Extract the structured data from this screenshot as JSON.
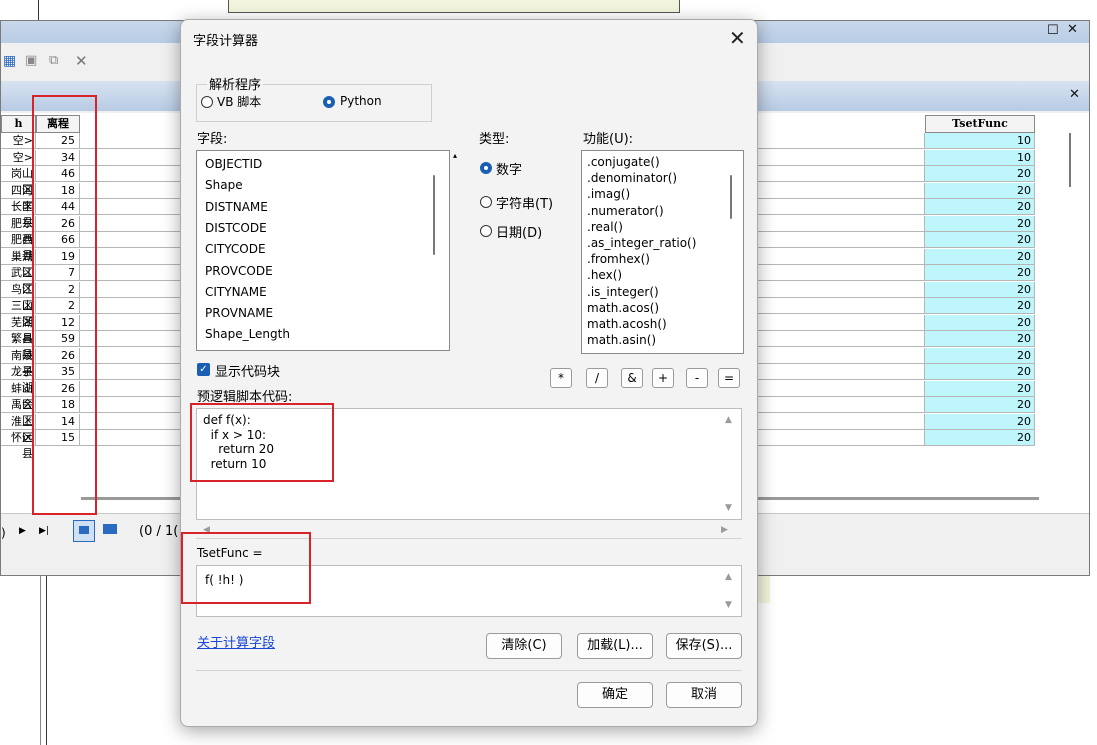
{
  "table": {
    "col_left_header": "h",
    "col_mileage_header": "离程",
    "col_func_header": "TsetFunc",
    "left_names": [
      "空>",
      "空>",
      "岗山区",
      "四河区",
      "长丰县",
      "肥东县",
      "肥西县",
      "巢湖区",
      "武江区",
      "鸟江区",
      "三山区",
      "芜湖县",
      "繁昌县",
      "南陵县",
      "龙子湖",
      "蚌山区",
      "禹会区",
      "淮上区",
      "怀远县"
    ],
    "mileage": [
      "25",
      "34",
      "46",
      "18",
      "44",
      "26",
      "66",
      "19",
      "7",
      "2",
      "2",
      "12",
      "59",
      "26",
      "35",
      "26",
      "18",
      "14",
      "15"
    ],
    "tsetfunc": [
      "10",
      "10",
      "20",
      "20",
      "20",
      "20",
      "20",
      "20",
      "20",
      "20",
      "20",
      "20",
      "20",
      "20",
      "20",
      "20",
      "20",
      "20",
      "20"
    ],
    "record_count": "(0 / 1("
  },
  "dialog": {
    "title": "字段计算器",
    "parser_label": "解析程序",
    "parser_vb": "VB 脚本",
    "parser_python": "Python",
    "fields_label": "字段:",
    "type_label": "类型:",
    "functions_label": "功能(U):",
    "fields": [
      "OBJECTID",
      "Shape",
      "DISTNAME",
      "DISTCODE",
      "CITYCODE",
      "PROVCODE",
      "CITYNAME",
      "PROVNAME",
      "Shape_Length"
    ],
    "type_number": "数字",
    "type_string": "字符串(T)",
    "type_date": "日期(D)",
    "functions": [
      ".conjugate()",
      ".denominator()",
      ".imag()",
      ".numerator()",
      ".real()",
      ".as_integer_ratio()",
      ".fromhex()",
      ".hex()",
      ".is_integer()",
      "math.acos()",
      "math.acosh()",
      "math.asin()"
    ],
    "show_codeblock": "显示代码块",
    "prelogic_label": "预逻辑脚本代码:",
    "code_lines": [
      "def f(x):",
      "  if x > 10:",
      "    return 20",
      "  return 10"
    ],
    "expression_label": "TsetFunc =",
    "expression": "f( !h! )",
    "operators": [
      "*",
      "/",
      "&",
      "+",
      "-",
      "="
    ],
    "about_link": "关于计算字段",
    "clear_button": "清除(C)",
    "load_button": "加载(L)...",
    "save_button": "保存(S)...",
    "ok_button": "确定",
    "cancel_button": "取消"
  },
  "colors": {
    "highlight_box": "#d9232b",
    "selected_cell": "#bff6fb",
    "accent": "#1a5fb4"
  }
}
